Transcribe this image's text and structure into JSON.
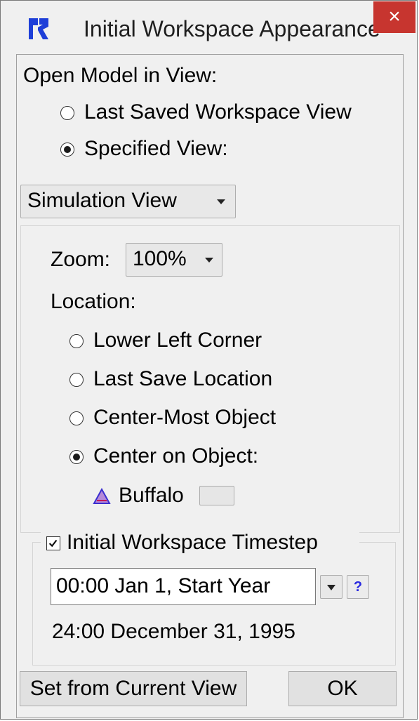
{
  "window": {
    "title": "Initial Workspace Appearance",
    "close_glyph": "×",
    "app_icon": "riverware-logo-icon"
  },
  "open_model": {
    "label": "Open Model in View:",
    "options": [
      {
        "label": "Last Saved Workspace View",
        "selected": false
      },
      {
        "label": "Specified View:",
        "selected": true
      }
    ]
  },
  "view_select": {
    "value": "Simulation View"
  },
  "zoom": {
    "label": "Zoom:",
    "value": "100%"
  },
  "location": {
    "label": "Location:",
    "options": [
      {
        "label": "Lower Left Corner",
        "selected": false
      },
      {
        "label": "Last Save Location",
        "selected": false
      },
      {
        "label": "Center-Most Object",
        "selected": false
      },
      {
        "label": "Center on Object:",
        "selected": true
      }
    ],
    "object": {
      "name": "Buffalo",
      "icon": "reservoir-triangle-icon"
    }
  },
  "timestep": {
    "checkbox_label": "Initial Workspace Timestep",
    "checked": true,
    "input_value": "00:00 Jan 1, Start Year",
    "help_glyph": "?",
    "resolved": "24:00 December 31, 1995"
  },
  "buttons": {
    "set_from_current": "Set from Current View",
    "ok": "OK"
  },
  "colors": {
    "close_bg": "#c7352f",
    "logo_blue": "#1e3fd8",
    "object_icon_fill": "#b58ad8",
    "object_icon_outline": "#3b2fd0",
    "help_color": "#2a2ae0"
  }
}
